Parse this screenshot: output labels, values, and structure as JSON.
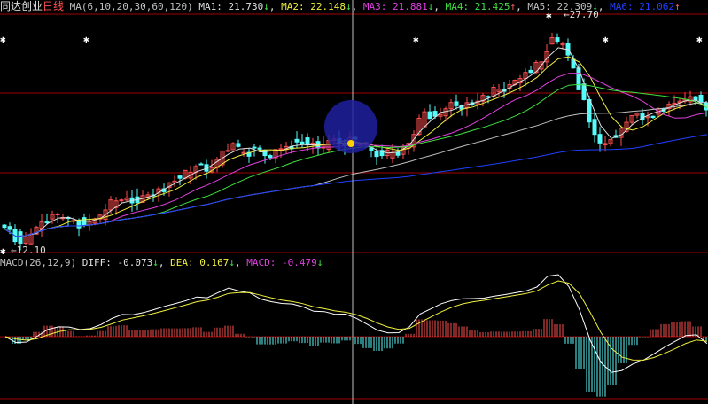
{
  "header": {
    "title": "同达创业",
    "period": "日线",
    "ma_params": "MA(6,10,20,30,60,120)",
    "ma": [
      {
        "label": "MA1:",
        "value": "21.730",
        "arrow": "↓",
        "color": "#e0e0e0"
      },
      {
        "label": "MA2:",
        "value": "22.148",
        "arrow": "↓",
        "color": "#f0f040"
      },
      {
        "label": "MA3:",
        "value": "21.881",
        "arrow": "↓",
        "color": "#e040e0"
      },
      {
        "label": "MA4:",
        "value": "21.425",
        "arrow": "↑",
        "color": "#40e040"
      },
      {
        "label": "MA5:",
        "value": "22.309",
        "arrow": "↓",
        "color": "#c0c0c0"
      },
      {
        "label": "MA6:",
        "value": "21.062",
        "arrow": "↑",
        "color": "#2040ff"
      }
    ]
  },
  "macd_header": {
    "params": "MACD(26,12,9)",
    "diff_label": "DIFF:",
    "diff": "-0.073",
    "diff_arrow": "↓",
    "dea_label": "DEA:",
    "dea": "0.167",
    "dea_arrow": "↓",
    "macd_label": "MACD:",
    "macd": "-0.479",
    "macd_arrow": "↓"
  },
  "annotations": {
    "high": "27.70",
    "low": "12.10"
  },
  "chart_data": {
    "type": "candlestick",
    "price_range": [
      12.1,
      27.7
    ],
    "closes": [
      13.5,
      12.6,
      13.2,
      14.0,
      14.5,
      14.3,
      14.1,
      13.8,
      14.2,
      14.8,
      15.4,
      15.6,
      15.3,
      15.8,
      16.2,
      16.6,
      16.9,
      17.3,
      17.8,
      17.6,
      18.7,
      19.2,
      18.6,
      18.9,
      18.4,
      18.8,
      19.0,
      19.3,
      19.1,
      18.9,
      19.4,
      19.2,
      19.6,
      19.1,
      18.7,
      18.4,
      18.6,
      18.9,
      19.8,
      21.3,
      21.0,
      21.5,
      21.7,
      21.9,
      22.0,
      22.3,
      22.8,
      23.1,
      23.5,
      23.9,
      24.6,
      26.2,
      25.8,
      24.2,
      22.1,
      19.8,
      19.2,
      19.6,
      20.6,
      21.2,
      21.0,
      21.5,
      21.8,
      22.0,
      22.3,
      21.9,
      20.5
    ],
    "ma_periods": [
      6,
      10,
      20,
      30,
      60,
      120
    ],
    "macd_params": [
      26,
      12,
      9
    ],
    "colors": {
      "up": "#ff5050",
      "down": "#54fcfc",
      "diff": "#ffffff",
      "dea": "#f0f040",
      "grid": "#a00000"
    }
  }
}
